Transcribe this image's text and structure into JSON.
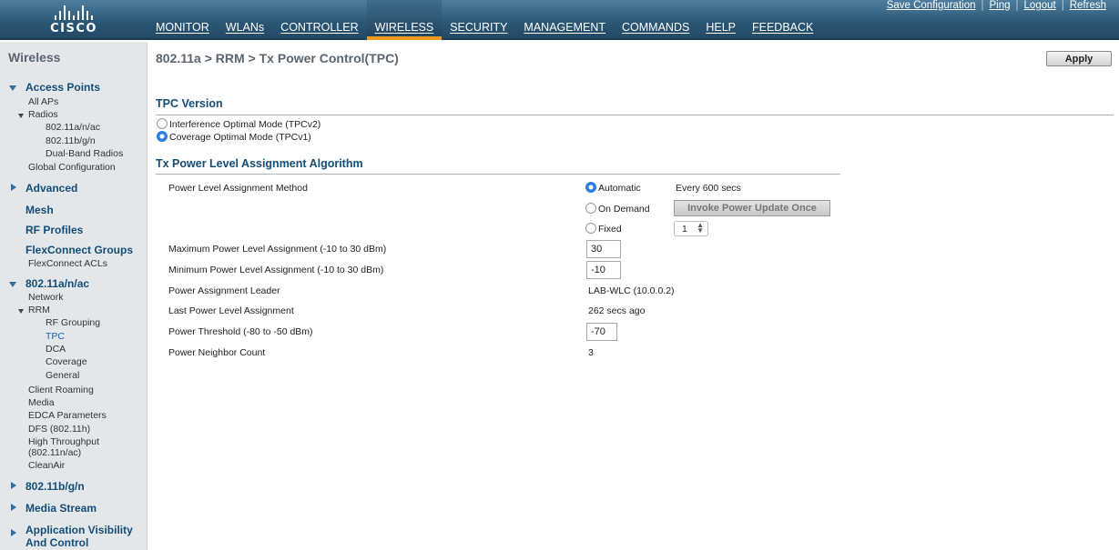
{
  "brand": {
    "logo_text": "CISCO"
  },
  "nav": {
    "items": [
      "MONITOR",
      "WLANs",
      "CONTROLLER",
      "WIRELESS",
      "SECURITY",
      "MANAGEMENT",
      "COMMANDS",
      "HELP",
      "FEEDBACK"
    ],
    "active": "WIRELESS"
  },
  "toplinks": {
    "save": "Save Configuration",
    "ping": "Ping",
    "logout": "Logout",
    "refresh": "Refresh"
  },
  "sidebar": {
    "title": "Wireless",
    "access_points": "Access Points",
    "all_aps": "All APs",
    "radios": "Radios",
    "radio_a": "802.11a/n/ac",
    "radio_b": "802.11b/g/n",
    "radio_dual": "Dual-Band Radios",
    "global_config": "Global Configuration",
    "advanced": "Advanced",
    "mesh": "Mesh",
    "rf_profiles": "RF Profiles",
    "flexconnect_groups": "FlexConnect Groups",
    "flexconnect_acls": "FlexConnect ACLs",
    "band_a": "802.11a/n/ac",
    "network": "Network",
    "rrm": "RRM",
    "rf_grouping": "RF Grouping",
    "tpc": "TPC",
    "dca": "DCA",
    "coverage": "Coverage",
    "general": "General",
    "client_roaming": "Client Roaming",
    "media": "Media",
    "edca": "EDCA Parameters",
    "dfs": "DFS (802.11h)",
    "high_throughput_1": "High Throughput",
    "high_throughput_2": "(802.11n/ac)",
    "cleanair": "CleanAir",
    "band_b": "802.11b/g/n",
    "media_stream": "Media Stream",
    "avc_1": "Application Visibility",
    "avc_2": "And Control"
  },
  "page": {
    "title": "802.11a > RRM > Tx Power Control(TPC)",
    "apply": "Apply",
    "tpc_version": {
      "heading": "TPC Version",
      "option_v2": "Interference Optimal Mode (TPCv2)",
      "option_v1": "Coverage Optimal Mode (TPCv1)",
      "selected": "TPCv1"
    },
    "algorithm": {
      "heading": "Tx Power Level Assignment Algorithm",
      "method_label": "Power Level Assignment Method",
      "automatic": "Automatic",
      "interval": "Every 600 secs",
      "on_demand": "On Demand",
      "invoke": "Invoke Power Update Once",
      "fixed": "Fixed",
      "fixed_value": "1",
      "selected_method": "Automatic",
      "max_label": "Maximum Power Level Assignment (-10 to 30 dBm)",
      "max_value": "30",
      "min_label": "Minimum Power Level Assignment (-10 to 30 dBm)",
      "min_value": "-10",
      "leader_label": "Power Assignment Leader",
      "leader_value": "LAB-WLC (10.0.0.2)",
      "last_label": "Last Power Level Assignment",
      "last_value": "262 secs ago",
      "threshold_label": "Power Threshold (-80 to -50 dBm)",
      "threshold_value": "-70",
      "neighbor_label": "Power Neighbor Count",
      "neighbor_value": "3"
    }
  },
  "colors": {
    "header": "#2a5675",
    "accent": "#f29b21",
    "section_link": "#124d77",
    "sidebar_bg": "#e4e7ea"
  }
}
